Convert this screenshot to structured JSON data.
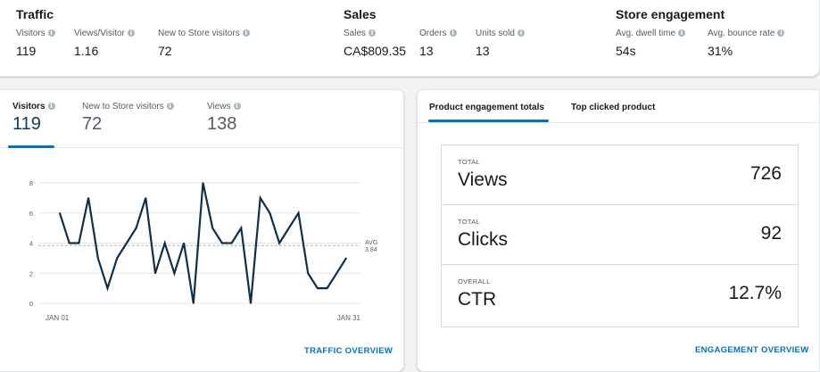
{
  "summary": {
    "traffic": {
      "title": "Traffic",
      "metrics": [
        {
          "label": "Visitors",
          "value": "119"
        },
        {
          "label": "Views/Visitor",
          "value": "1.16"
        },
        {
          "label": "New to Store visitors",
          "value": "72"
        }
      ]
    },
    "sales": {
      "title": "Sales",
      "metrics": [
        {
          "label": "Sales",
          "value": "CA$809.35"
        },
        {
          "label": "Orders",
          "value": "13"
        },
        {
          "label": "Units sold",
          "value": "13"
        }
      ]
    },
    "engagement": {
      "title": "Store engagement",
      "metrics": [
        {
          "label": "Avg. dwell time",
          "value": "54s"
        },
        {
          "label": "Avg. bounce rate",
          "value": "31%"
        }
      ]
    }
  },
  "traffic_card": {
    "tabs": [
      {
        "label": "Visitors",
        "value": "119"
      },
      {
        "label": "New to Store visitors",
        "value": "72"
      },
      {
        "label": "Views",
        "value": "138"
      }
    ],
    "link": "TRAFFIC OVERVIEW"
  },
  "chart_data": {
    "type": "line",
    "x_start_label": "JAN 01",
    "x_end_label": "JAN 31",
    "ylim": [
      0,
      8
    ],
    "yticks": [
      "0",
      "2",
      "4",
      "6",
      "8"
    ],
    "grid": true,
    "avg_label": "AVG",
    "avg_value_label": "3.84",
    "avg": 3.84,
    "line_color": "#0f3049",
    "values": [
      6,
      4,
      4,
      7,
      3,
      1,
      3,
      4,
      5,
      7,
      2,
      4,
      2,
      4,
      0,
      8,
      5,
      4,
      4,
      5,
      0,
      7,
      6,
      4,
      5,
      6,
      2,
      1,
      1,
      2,
      3
    ]
  },
  "engagement_card": {
    "tabs": [
      "Product engagement totals",
      "Top clicked product"
    ],
    "rows": [
      {
        "small": "TOTAL",
        "name": "Views",
        "value": "726"
      },
      {
        "small": "TOTAL",
        "name": "Clicks",
        "value": "92"
      },
      {
        "small": "OVERALL",
        "name": "CTR",
        "value": "12.7%"
      }
    ],
    "link": "ENGAGEMENT OVERVIEW"
  },
  "colors": {
    "accent": "#0073bb",
    "line": "#0f3049"
  }
}
